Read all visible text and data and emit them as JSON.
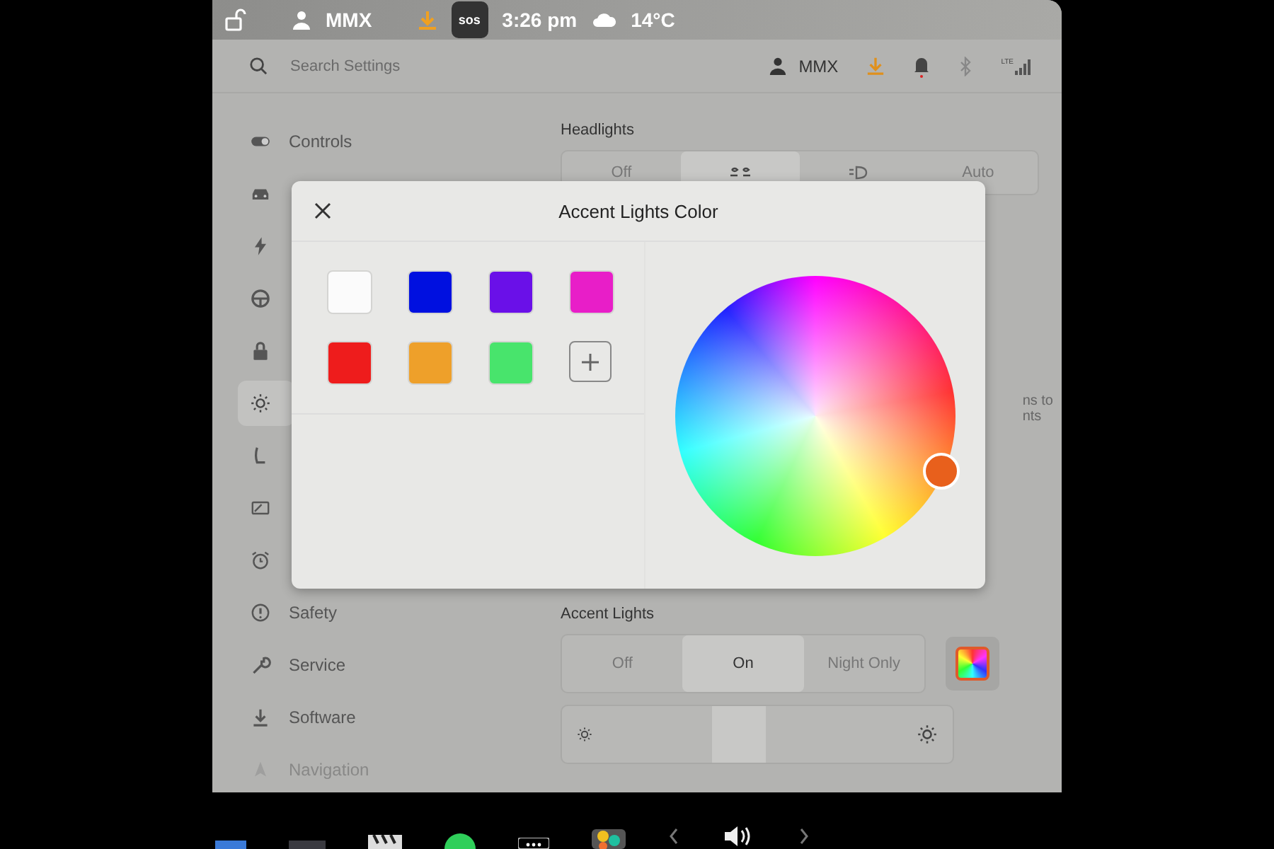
{
  "status_bar": {
    "user": "MMX",
    "sos": "sos",
    "time": "3:26 pm",
    "temperature": "14°C"
  },
  "header": {
    "search": {
      "placeholder": "Search Settings"
    },
    "user": "MMX",
    "network": "LTE"
  },
  "sidebar": {
    "items": [
      {
        "label": "Controls",
        "selected": false
      },
      {
        "selected": false
      },
      {
        "selected": false
      },
      {
        "selected": false
      },
      {
        "selected": false
      },
      {
        "selected": true
      },
      {
        "selected": false
      },
      {
        "selected": false
      },
      {
        "selected": false
      },
      {
        "label": "Safety",
        "selected": false
      },
      {
        "label": "Service",
        "selected": false
      },
      {
        "label": "Software",
        "selected": false
      },
      {
        "label": "Navigation",
        "selected": false
      }
    ]
  },
  "headlights": {
    "label": "Headlights",
    "options": [
      {
        "kind": "text",
        "label": "Off",
        "selected": false
      },
      {
        "kind": "icon",
        "selected": true
      },
      {
        "kind": "icon",
        "selected": false
      },
      {
        "kind": "text",
        "label": "Auto",
        "selected": false
      }
    ]
  },
  "side_note": [
    "ns to",
    "nts"
  ],
  "accent_lights": {
    "label": "Accent Lights",
    "options": [
      {
        "label": "Off",
        "selected": false
      },
      {
        "label": "On",
        "selected": true
      },
      {
        "label": "Night Only",
        "selected": false
      }
    ],
    "brightness": {
      "level": 0.45
    }
  },
  "dialog": {
    "title": "Accent Lights Color",
    "swatches": [
      {
        "color": "#fbfbfb"
      },
      {
        "color": "#0010e0"
      },
      {
        "color": "#6a10e8"
      },
      {
        "color": "#e81ec8"
      },
      {
        "color": "#ee1c1c"
      },
      {
        "color": "#eea02a"
      },
      {
        "color": "#48e46c"
      }
    ],
    "picker": {
      "color": "#e8601c"
    }
  }
}
